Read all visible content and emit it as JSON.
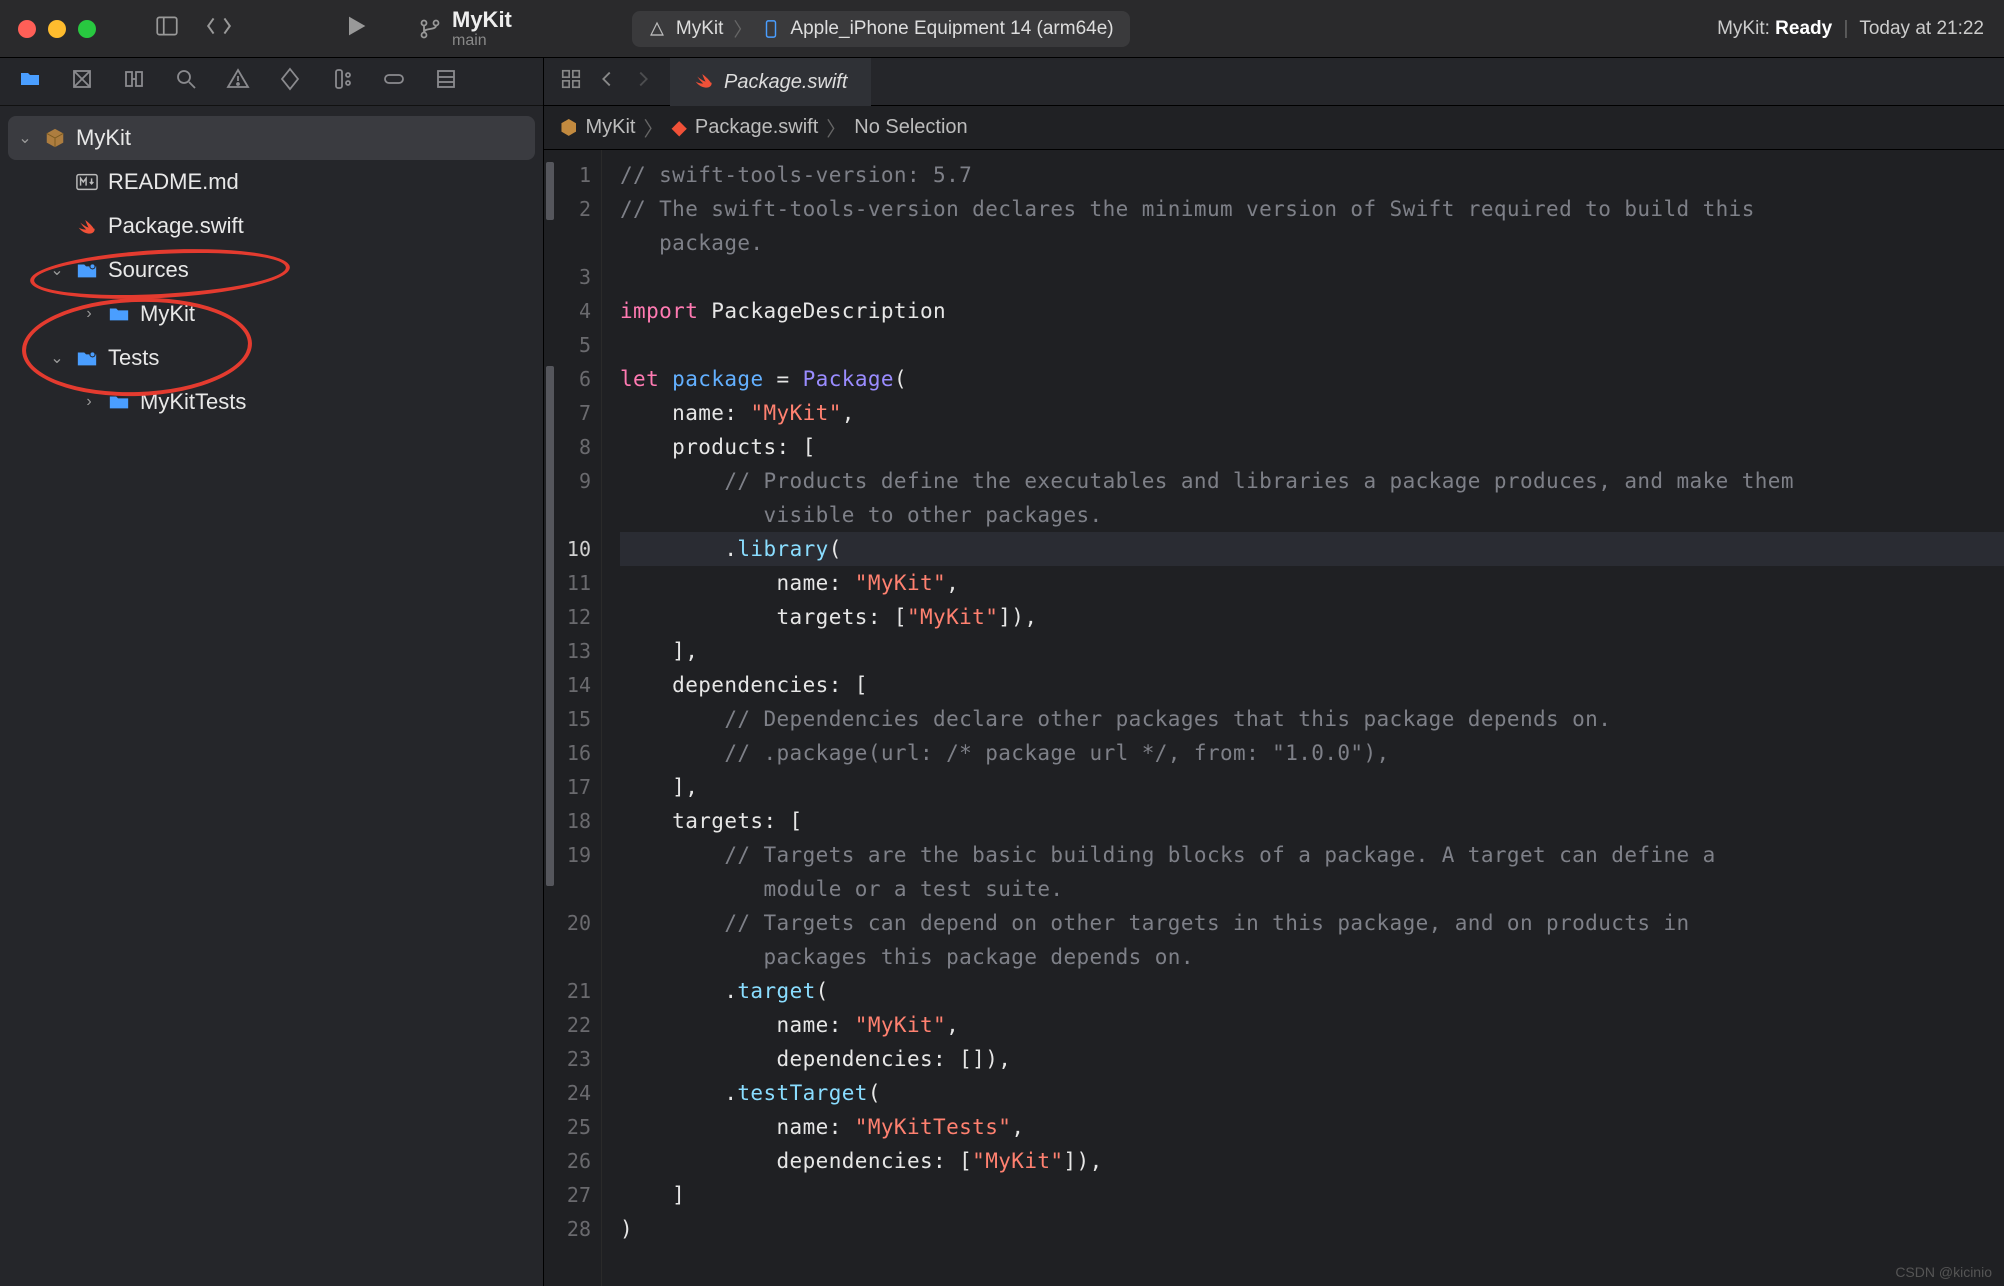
{
  "titlebar": {
    "project": "MyKit",
    "branch": "main",
    "scheme_target": "MyKit",
    "scheme_device": "Apple_iPhone Equipment 14 (arm64e)",
    "status_project": "MyKit:",
    "status_state": "Ready",
    "status_time": "Today at 21:22"
  },
  "sidebar": {
    "root": "MyKit",
    "items": {
      "readme": "README.md",
      "package": "Package.swift",
      "sources": "Sources",
      "sources_child": "MyKit",
      "tests": "Tests",
      "tests_child": "MyKitTests"
    }
  },
  "editor": {
    "tab_label": "Package.swift",
    "jumpbar": {
      "p0": "MyKit",
      "p1": "Package.swift",
      "p2": "No Selection"
    }
  },
  "code": {
    "lines": [
      "1",
      "2",
      "3",
      "4",
      "5",
      "6",
      "7",
      "8",
      "9",
      "10",
      "11",
      "12",
      "13",
      "14",
      "15",
      "16",
      "17",
      "18",
      "19",
      "20",
      "21",
      "22",
      "23",
      "24",
      "25",
      "26",
      "27",
      "28"
    ],
    "l1": "// swift-tools-version: 5.7",
    "l2a": "// The swift-tools-version declares the minimum version of Swift required to build this",
    "l2b": "   package.",
    "l4_kw": "import",
    "l4_rest": " PackageDescription",
    "l6_kw": "let",
    "l6_id": " package",
    "l6_rest1": " = ",
    "l6_type": "Package",
    "l6_rest2": "(",
    "l7a": "    name: ",
    "l7s": "\"MyKit\"",
    "l7b": ",",
    "l8": "    products: [",
    "l9a": "        // Products define the executables and libraries a package produces, and make them",
    "l9b": "           visible to other packages.",
    "l10a": "        .",
    "l10fn": "library",
    "l10b": "(",
    "l11a": "            name: ",
    "l11s": "\"MyKit\"",
    "l11b": ",",
    "l12a": "            targets: [",
    "l12s": "\"MyKit\"",
    "l12b": "]),",
    "l13": "    ],",
    "l14": "    dependencies: [",
    "l15": "        // Dependencies declare other packages that this package depends on.",
    "l16": "        // .package(url: /* package url */, from: \"1.0.0\"),",
    "l17": "    ],",
    "l18": "    targets: [",
    "l19a": "        // Targets are the basic building blocks of a package. A target can define a",
    "l19b": "           module or a test suite.",
    "l20a": "        // Targets can depend on other targets in this package, and on products in",
    "l20b": "           packages this package depends on.",
    "l21a": "        .",
    "l21fn": "target",
    "l21b": "(",
    "l22a": "            name: ",
    "l22s": "\"MyKit\"",
    "l22b": ",",
    "l23": "            dependencies: []),",
    "l24a": "        .",
    "l24fn": "testTarget",
    "l24b": "(",
    "l25a": "            name: ",
    "l25s": "\"MyKitTests\"",
    "l25b": ",",
    "l26a": "            dependencies: [",
    "l26s": "\"MyKit\"",
    "l26b": "]),",
    "l27": "    ]",
    "l28": ")"
  },
  "watermark": "CSDN @kicinio"
}
